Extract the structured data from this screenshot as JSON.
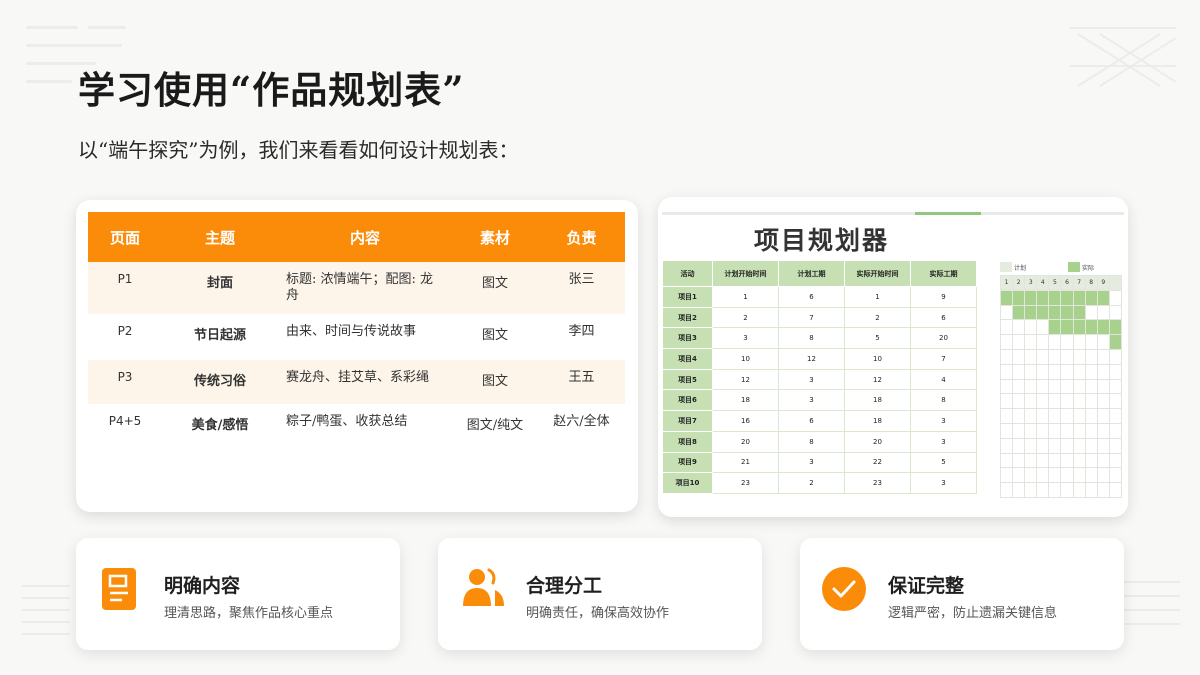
{
  "title": "学习使用“作品规划表”",
  "subtitle": "以“端午探究”为例，我们来看看如何设计规划表：",
  "accent": "#fb8c0a",
  "plan_table": {
    "headers": [
      "页面",
      "主题",
      "内容",
      "素材",
      "负责"
    ],
    "rows": [
      {
        "page": "P1",
        "theme": "封面",
        "content": "标题: 浓情端午；配图: 龙舟",
        "material": "图文",
        "owner": "张三"
      },
      {
        "page": "P2",
        "theme": "节日起源",
        "content": "由来、时间与传说故事",
        "material": "图文",
        "owner": "李四"
      },
      {
        "page": "P3",
        "theme": "传统习俗",
        "content": "赛龙舟、挂艾草、系彩绳",
        "material": "图文",
        "owner": "王五"
      },
      {
        "page": "P4+5",
        "theme": "美食/感悟",
        "content": "粽子/鸭蛋、收获总结",
        "material": "图文/纯文",
        "owner": "赵六/全体"
      }
    ]
  },
  "sheet": {
    "title": "项目规划器",
    "headers": [
      "活动",
      "计划开始时间",
      "计划工期",
      "实际开始时间",
      "实际工期"
    ],
    "rows": [
      [
        "项目1",
        "1",
        "6",
        "1",
        "9"
      ],
      [
        "项目2",
        "2",
        "7",
        "2",
        "6"
      ],
      [
        "项目3",
        "3",
        "8",
        "5",
        "20"
      ],
      [
        "项目4",
        "10",
        "12",
        "10",
        "7"
      ],
      [
        "项目5",
        "12",
        "3",
        "12",
        "4"
      ],
      [
        "项目6",
        "18",
        "3",
        "18",
        "8"
      ],
      [
        "项目7",
        "16",
        "6",
        "18",
        "3"
      ],
      [
        "项目8",
        "20",
        "8",
        "20",
        "3"
      ],
      [
        "项目9",
        "21",
        "3",
        "22",
        "5"
      ],
      [
        "项目10",
        "23",
        "2",
        "23",
        "3"
      ]
    ],
    "legend": [
      "计划",
      "实际"
    ],
    "gantt_days": [
      "1",
      "2",
      "3",
      "4",
      "5",
      "6",
      "7",
      "8",
      "9"
    ],
    "gantt_color_plan": "#e5ecdf",
    "gantt_color_actual": "#a9d18e"
  },
  "features": [
    {
      "icon": "document-icon",
      "title": "明确内容",
      "desc": "理清思路，聚焦作品核心重点"
    },
    {
      "icon": "team-icon",
      "title": "合理分工",
      "desc": "明确责任，确保高效协作"
    },
    {
      "icon": "check-circle-icon",
      "title": "保证完整",
      "desc": "逻辑严密，防止遗漏关键信息"
    }
  ]
}
